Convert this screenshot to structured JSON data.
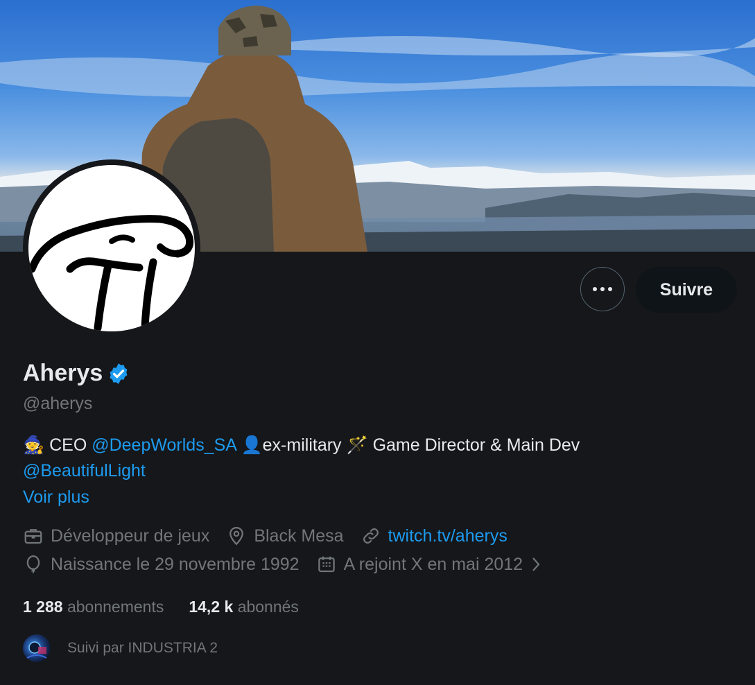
{
  "profile": {
    "name": "Aherys",
    "handle": "@aherys",
    "bio_emoji_1": "🧙",
    "bio_ceo": " CEO ",
    "bio_mention_1": "@DeepWorlds_SA",
    "bio_emoji_2": " 👤",
    "bio_text_2": "ex-military ",
    "bio_emoji_3": "🪄",
    "bio_text_3": " Game Director & Main Dev",
    "bio_mention_2": "@BeautifulLight",
    "see_more": "Voir plus"
  },
  "meta": {
    "job": "Développeur de jeux",
    "location": "Black Mesa",
    "website": "twitch.tv/aherys",
    "birth": "Naissance le 29 novembre 1992",
    "joined": "A rejoint X en mai 2012"
  },
  "stats": {
    "following_count": "1 288",
    "following_label": "abonnements",
    "followers_count": "14,2 k",
    "followers_label": "abonnés"
  },
  "followed_by": "Suivi par INDUSTRIA 2",
  "buttons": {
    "follow": "Suivre"
  },
  "colors": {
    "background": "#16171a",
    "accent": "#1d9bf0",
    "muted": "#71767b",
    "text": "#e7e9ea"
  }
}
